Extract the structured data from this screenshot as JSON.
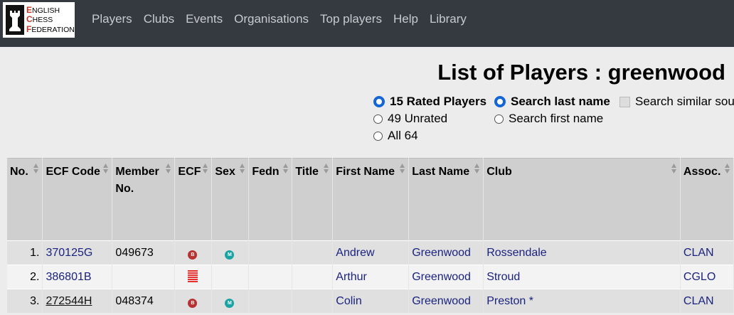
{
  "logo": {
    "line1_initial": "E",
    "line1_rest": "NGLISH",
    "line2_initial": "C",
    "line2_rest": "HESS",
    "line3_initial": "F",
    "line3_rest": "EDERATION"
  },
  "nav": [
    "Players",
    "Clubs",
    "Events",
    "Organisations",
    "Top players",
    "Help",
    "Library"
  ],
  "title": "List of Players : greenwood",
  "filters": {
    "rated": "15 Rated Players",
    "unrated": "49 Unrated",
    "all": "All 64",
    "last_name": "Search last name",
    "first_name": "Search first name",
    "similar": "Search similar soun"
  },
  "columns": [
    "No.",
    "ECF Code",
    "Member No.",
    "ECF",
    "Sex",
    "Fedn",
    "Title",
    "First Name",
    "Last Name",
    "Club",
    "Assoc."
  ],
  "rows": [
    {
      "no": "1.",
      "code": "370125G",
      "member": "049673",
      "ecf": "B",
      "sex": "M",
      "fedn": "",
      "title": "",
      "first": "Andrew",
      "last": "Greenwood",
      "club": "Rossendale",
      "assoc": "CLAN"
    },
    {
      "no": "2.",
      "code": "386801B",
      "member": "",
      "ecf": "bars-icon",
      "sex": "",
      "fedn": "",
      "title": "",
      "first": "Arthur",
      "last": "Greenwood",
      "club": "Stroud",
      "assoc": "CGLO"
    },
    {
      "no": "3.",
      "code": "272544H",
      "member": "048374",
      "ecf": "B",
      "sex": "M",
      "fedn": "",
      "title": "",
      "first": "Colin",
      "last": "Greenwood",
      "club": "Preston *",
      "assoc": "CLAN"
    }
  ]
}
